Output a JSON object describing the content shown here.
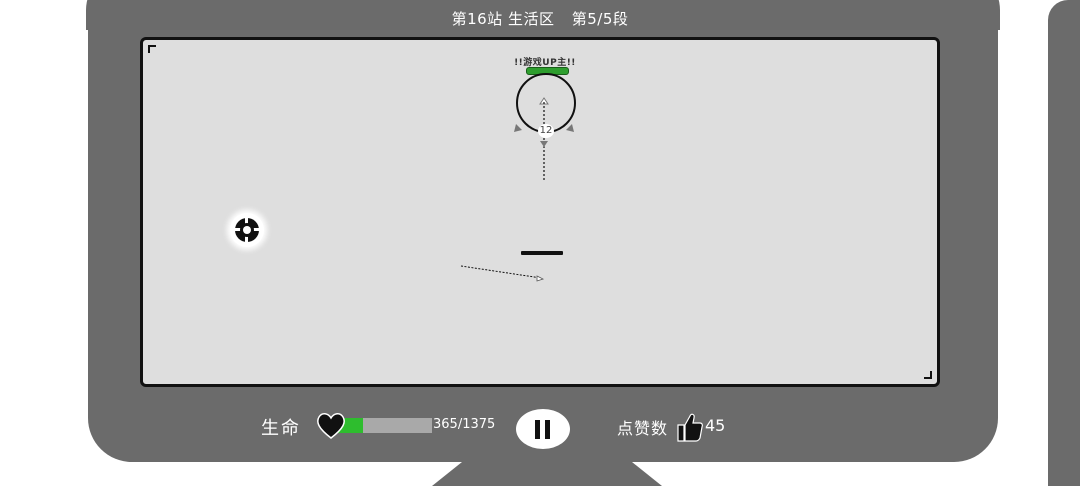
{
  "header": {
    "station": "第16站 生活区",
    "segment": "第5/5段"
  },
  "boss": {
    "label": "!!游戏UP主!!",
    "counter": "12",
    "hp_fraction": 1.0
  },
  "hud": {
    "life_label": "生命",
    "hp_current": 365,
    "hp_max": 1375,
    "hp_text": "365/1375",
    "likes_label": "点赞数",
    "likes_count": "45"
  },
  "icons": {
    "life": "heart-icon",
    "pause": "pause-icon",
    "likes": "thumbs-up-icon",
    "target": "crosshair-target-icon"
  },
  "colors": {
    "frame": "#6b6b6b",
    "screen": "#dedede",
    "hp_fill": "#2ebd2e",
    "hp_track": "#a9a9a9",
    "boss_hp": "#2e9e2e"
  }
}
